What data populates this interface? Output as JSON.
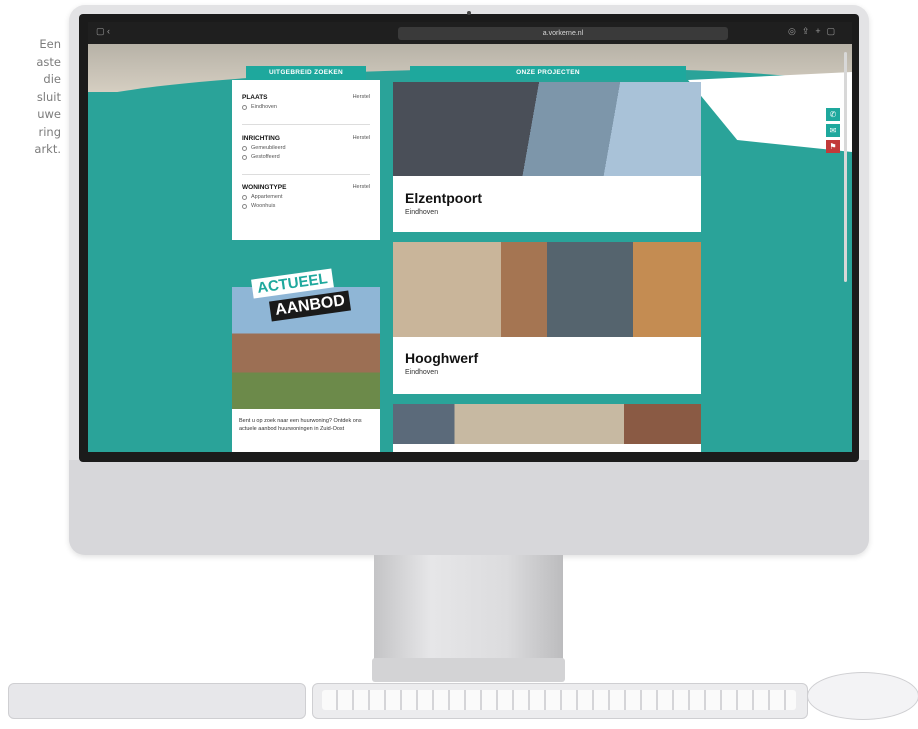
{
  "caption": [
    "Een",
    "aste",
    "die",
    "sluit",
    "uwe",
    "ring",
    "arkt."
  ],
  "browser": {
    "url": "a.vorkerne.nl"
  },
  "site": {
    "tab_search": "UITGEBREID ZOEKEN",
    "tab_projects": "ONZE PROJECTEN",
    "filters": [
      {
        "title": "PLAATS",
        "reset": "Herstel",
        "options": [
          "Eindhoven"
        ]
      },
      {
        "title": "INRICHTING",
        "reset": "Herstel",
        "options": [
          "Gemeubileerd",
          "Gestoffeerd"
        ]
      },
      {
        "title": "WONINGTYPE",
        "reset": "Herstel",
        "options": [
          "Appartement",
          "Woonhuis"
        ]
      }
    ],
    "promo": {
      "line1": "ACTUEEL",
      "line2": "AANBOD",
      "text": "Bent u op zoek naar een huurwoning? Ontdek ons actuele aanbod huurwoningen in Zuid-Oost"
    },
    "projects": [
      {
        "name": "Elzentpoort",
        "city": "Eindhoven"
      },
      {
        "name": "Hooghwerf",
        "city": "Eindhoven"
      }
    ],
    "side_icons": [
      "phone-icon",
      "mail-icon",
      "flag-icon"
    ]
  }
}
